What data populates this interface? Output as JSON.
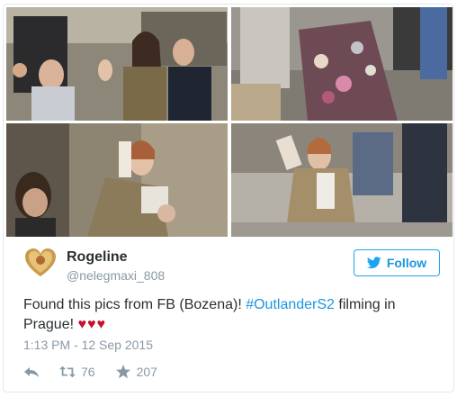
{
  "tweet": {
    "user": {
      "name": "Rogeline",
      "handle": "@nelegmaxi_808",
      "avatar_icon": "heart-avatar-icon"
    },
    "follow_label": "Follow",
    "text": {
      "part1": "Found this pics from FB (Bozena)! ",
      "hashtag": "#OutlanderS2",
      "part2": " filming in Prague! ",
      "hearts": "♥♥♥"
    },
    "timestamp": "1:13 PM - 12 Sep 2015",
    "retweets": "76",
    "likes": "207"
  },
  "photos": [
    {
      "icon": "photo-1"
    },
    {
      "icon": "photo-2"
    },
    {
      "icon": "photo-3"
    },
    {
      "icon": "photo-4"
    }
  ],
  "colors": {
    "accent": "#1da1f2",
    "link": "#1b95e0",
    "muted": "#8899a6",
    "heart": "#c7102e"
  }
}
